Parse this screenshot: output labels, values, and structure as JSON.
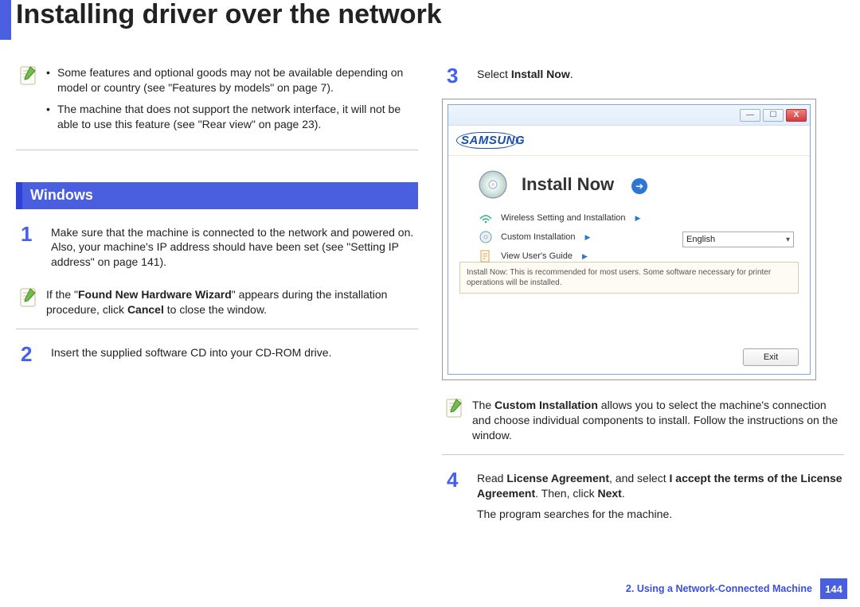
{
  "title": "Installing driver over the network",
  "top_notes": [
    "Some features and optional goods may not be available depending on model or country (see \"Features by models\" on page 7).",
    "The machine that does not support the network interface, it will not be able to use this feature (see \"Rear view\" on page 23)."
  ],
  "section_heading": "Windows",
  "steps": {
    "s1": {
      "num": "1",
      "text": "Make sure that the machine is connected to the network and powered on. Also, your machine's IP address should have been set (see \"Setting IP address\" on page 141)."
    },
    "s1_note": {
      "prefix": "If the \"",
      "bold1": "Found New Hardware Wizard",
      "mid": "\" appears during the installation procedure, click ",
      "bold2": "Cancel",
      "suffix": " to close the window."
    },
    "s2": {
      "num": "2",
      "text": "Insert the supplied software CD into your CD-ROM drive."
    },
    "s3": {
      "num": "3",
      "prefix": "Select ",
      "bold": "Install Now",
      "suffix": "."
    },
    "s3_note": {
      "prefix": "The ",
      "bold": "Custom Installation",
      "suffix": " allows you to select the machine's connection and choose individual components to install. Follow the instructions on the window."
    },
    "s4": {
      "num": "4",
      "p1_prefix": "Read ",
      "p1_b1": "License Agreement",
      "p1_mid": ", and select ",
      "p1_b2": "I accept the terms of the License Agreement",
      "p1_mid2": ". Then, click ",
      "p1_b3": "Next",
      "p1_suffix": ".",
      "p2": "The program searches for the machine."
    }
  },
  "installer": {
    "brand": "SAMSUNG",
    "install_now": "Install Now",
    "opts": {
      "wireless": "Wireless Setting and Installation",
      "custom": "Custom Installation",
      "guide": "View User's Guide"
    },
    "language": "English",
    "desc": "Install Now: This is recommended for most users. Some software necessary for printer operations will be installed.",
    "exit": "Exit"
  },
  "footer": {
    "chapter": "2.  Using a Network-Connected Machine",
    "page": "144"
  }
}
